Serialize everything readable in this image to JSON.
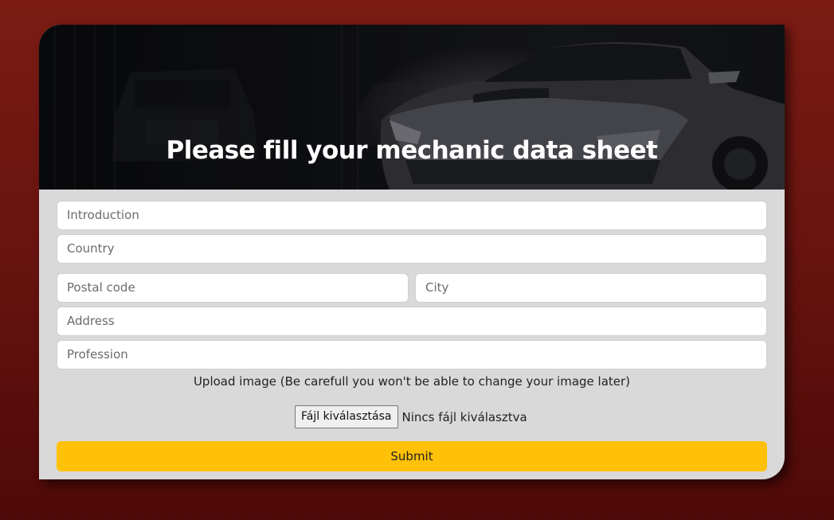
{
  "header": {
    "title": "Please fill your mechanic data sheet"
  },
  "form": {
    "introduction_placeholder": "Introduction",
    "country_placeholder": "Country",
    "postal_code_placeholder": "Postal code",
    "city_placeholder": "City",
    "address_placeholder": "Address",
    "profession_placeholder": "Profession",
    "upload_label": "Upload image (Be carefull you won't be able to change your image later)",
    "file_button_label": "Fájl kiválasztása",
    "file_status": "Nincs fájl kiválasztva",
    "submit_label": "Submit"
  },
  "colors": {
    "accent": "#ffc107",
    "background": "#6a1410",
    "card": "#d9d9d9"
  }
}
